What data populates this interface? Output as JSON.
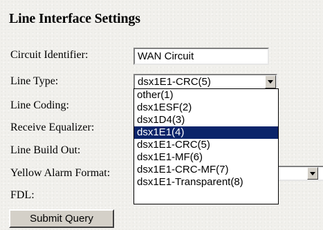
{
  "page": {
    "title": "Line Interface Settings"
  },
  "form": {
    "labels": {
      "circuit_identifier": "Circuit Identifier:",
      "line_type": "Line Type:",
      "line_coding": "Line Coding:",
      "receive_equalizer": "Receive Equalizer:",
      "line_build_out": "Line Build Out:",
      "yellow_alarm_format": "Yellow Alarm Format:",
      "fdl": "FDL:"
    },
    "circuit_identifier_value": "WAN Circuit",
    "line_type_value": "dsx1E1-CRC(5)",
    "line_type_options": [
      "other(1)",
      "dsx1ESF(2)",
      "dsx1D4(3)",
      "dsx1E1(4)",
      "dsx1E1-CRC(5)",
      "dsx1E1-MF(6)",
      "dsx1E1-CRC-MF(7)",
      "dsx1E1-Transparent(8)"
    ],
    "highlighted_option": "dsx1E1(4)",
    "submit_label": "Submit Query"
  },
  "colors": {
    "highlight_background": "#0a246a",
    "page_background": "#f1f0ec"
  }
}
